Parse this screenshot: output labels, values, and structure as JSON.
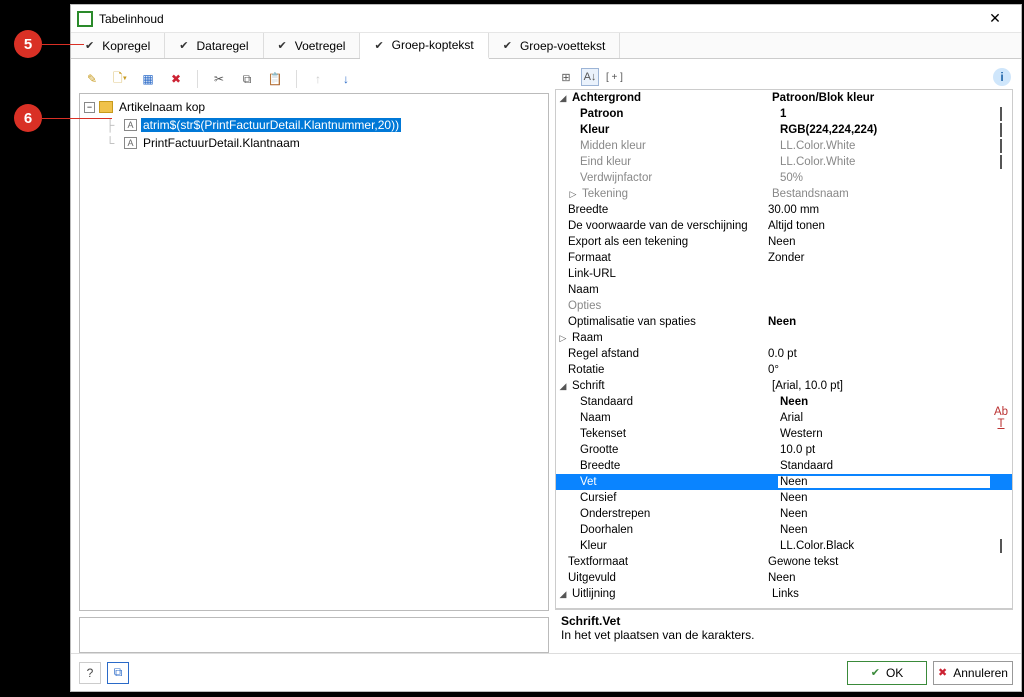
{
  "callouts": {
    "c5": "5",
    "c6": "6"
  },
  "window": {
    "title": "Tabelinhoud",
    "close": "✕"
  },
  "tabs": {
    "t1": "Kopregel",
    "t2": "Dataregel",
    "t3": "Voetregel",
    "t4": "Groep-koptekst",
    "t5": "Groep-voettekst"
  },
  "tree": {
    "root": "Artikelnaam kop",
    "n1": "atrim$(str$(PrintFactuurDetail.Klantnummer,20))",
    "n2": "PrintFactuurDetail.Klantnaam"
  },
  "ptb": {
    "expand": "[ + ]"
  },
  "props": {
    "achtergrond_l": "Achtergrond",
    "achtergrond_v": "Patroon/Blok kleur",
    "patroon_l": "Patroon",
    "patroon_v": "1",
    "kleur_l": "Kleur",
    "kleur_v": "RGB(224,224,224)",
    "middenkleur_l": "Midden kleur",
    "middenkleur_v": "LL.Color.White",
    "eindkleur_l": "Eind kleur",
    "eindkleur_v": "LL.Color.White",
    "verdwijn_l": "Verdwijnfactor",
    "verdwijn_v": "50%",
    "tekening_l": "Tekening",
    "tekening_v": "Bestandsnaam",
    "breedte_l": "Breedte",
    "breedte_v": "30.00 mm",
    "voorwaarde_l": "De voorwaarde van de verschijning",
    "voorwaarde_v": "Altijd tonen",
    "export_l": "Export als een tekening",
    "export_v": "Neen",
    "formaat_l": "Formaat",
    "formaat_v": "Zonder",
    "linkurl_l": "Link-URL",
    "linkurl_v": "",
    "naam_l": "Naam",
    "naam_v": "",
    "opties_l": "Opties",
    "optspaties_l": "Optimalisatie van spaties",
    "optspaties_v": "Neen",
    "raam_l": "Raam",
    "regelafst_l": "Regel afstand",
    "regelafst_v": "0.0 pt",
    "rotatie_l": "Rotatie",
    "rotatie_v": "0°",
    "schrift_l": "Schrift",
    "schrift_v": "[Arial, 10.0 pt]",
    "standaard_l": "Standaard",
    "standaard_v": "Neen",
    "snaam_l": "Naam",
    "snaam_v": "Arial",
    "tekenset_l": "Tekenset",
    "tekenset_v": "Western",
    "grootte_l": "Grootte",
    "grootte_v": "10.0 pt",
    "sbreedte_l": "Breedte",
    "sbreedte_v": "Standaard",
    "vet_l": "Vet",
    "vet_v": "Neen",
    "cursief_l": "Cursief",
    "cursief_v": "Neen",
    "onderstr_l": "Onderstrepen",
    "onderstr_v": "Neen",
    "doorhalen_l": "Doorhalen",
    "doorhalen_v": "Neen",
    "skleur_l": "Kleur",
    "skleur_v": "LL.Color.Black",
    "textformaat_l": "Textformaat",
    "textformaat_v": "Gewone tekst",
    "uitgevuld_l": "Uitgevuld",
    "uitgevuld_v": "Neen",
    "uitlijning_l": "Uitlijning",
    "uitlijning_v": "Links"
  },
  "desc": {
    "title": "Schrift.Vet",
    "text": "In het vet plaatsen van de karakters."
  },
  "footer": {
    "ok": "OK",
    "cancel": "Annuleren"
  }
}
